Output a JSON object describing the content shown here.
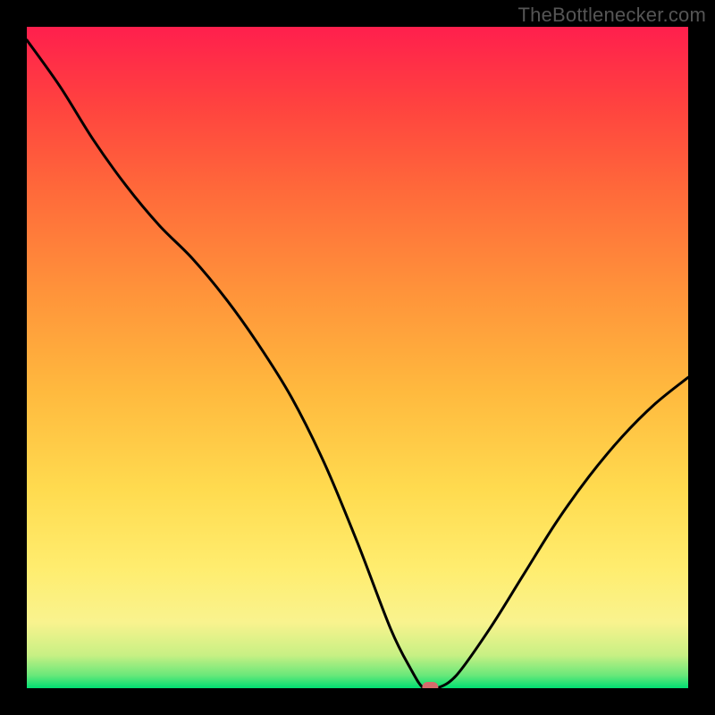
{
  "attribution": "TheBottlenecker.com",
  "chart_data": {
    "type": "line",
    "title": "",
    "xlabel": "",
    "ylabel": "",
    "xlim": [
      0,
      100
    ],
    "ylim": [
      0,
      100
    ],
    "x": [
      0,
      5,
      10,
      15,
      20,
      25,
      30,
      35,
      40,
      45,
      50,
      55,
      58,
      60,
      62,
      65,
      70,
      75,
      80,
      85,
      90,
      95,
      100
    ],
    "values": [
      98,
      91,
      83,
      76,
      70,
      65,
      59,
      52,
      44,
      34,
      22,
      9,
      3,
      0,
      0,
      2,
      9,
      17,
      25,
      32,
      38,
      43,
      47
    ],
    "marker": {
      "x": 61,
      "y": 0,
      "color": "#d66b6b"
    },
    "gradient_stops": [
      {
        "offset": 0,
        "color": "#00df72"
      },
      {
        "offset": 0.02,
        "color": "#6be87a"
      },
      {
        "offset": 0.05,
        "color": "#c8f084"
      },
      {
        "offset": 0.1,
        "color": "#f9f38e"
      },
      {
        "offset": 0.18,
        "color": "#ffed6f"
      },
      {
        "offset": 0.3,
        "color": "#ffdb4f"
      },
      {
        "offset": 0.45,
        "color": "#ffb93e"
      },
      {
        "offset": 0.6,
        "color": "#ff933a"
      },
      {
        "offset": 0.75,
        "color": "#ff6a3a"
      },
      {
        "offset": 0.88,
        "color": "#ff433f"
      },
      {
        "offset": 1.0,
        "color": "#ff1f4d"
      }
    ]
  }
}
